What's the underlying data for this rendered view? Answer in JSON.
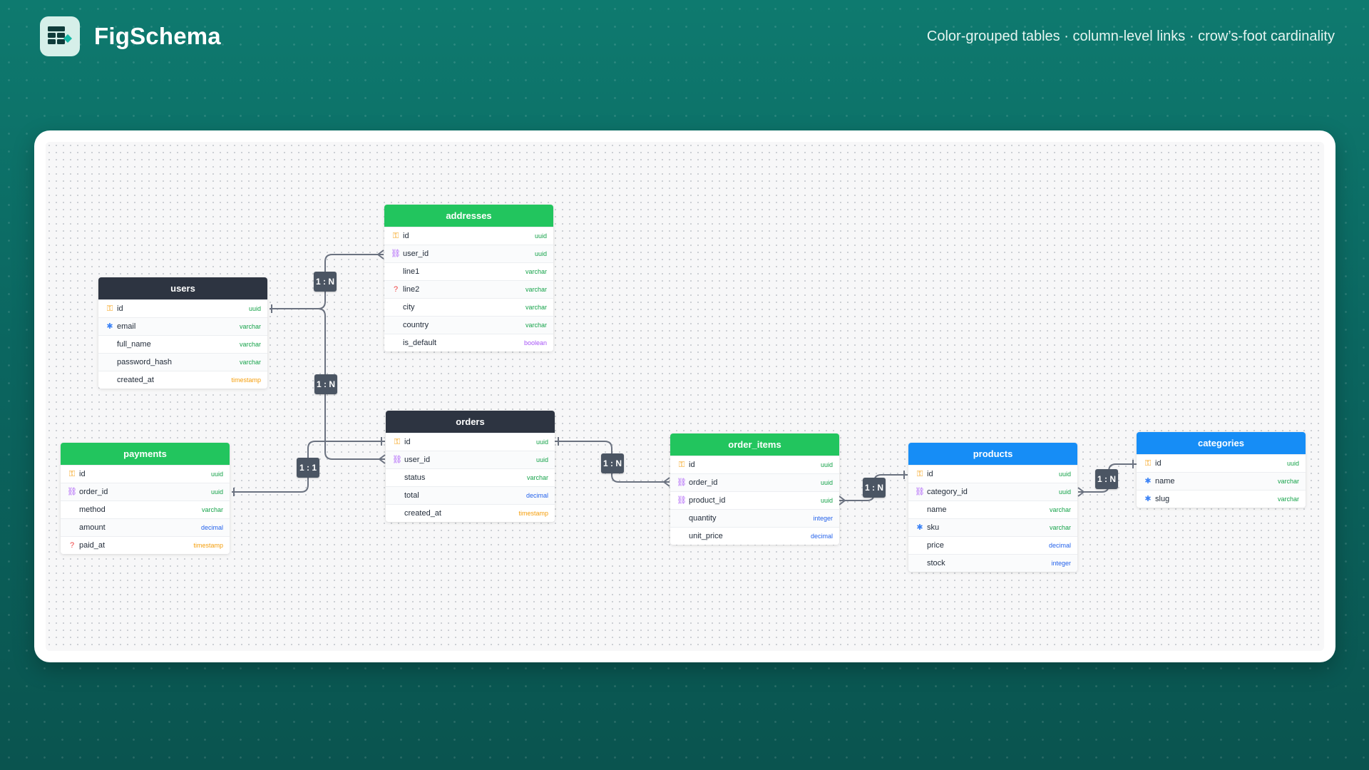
{
  "app": {
    "title": "FigSchema",
    "tagline": "Color-grouped tables · column-level links · crow’s-foot cardinality"
  },
  "colors": {
    "dark": "#2d3441",
    "green": "#22c55e",
    "blue": "#168df6",
    "uuid": "#16a34a",
    "varchar": "#16a34a",
    "timestamp": "#f59e0b",
    "decimal": "#2563eb",
    "integer": "#2563eb",
    "boolean": "#a855f7"
  },
  "tables": [
    {
      "name": "users",
      "color": "dark",
      "columns": [
        {
          "name": "id",
          "type": "uuid",
          "icon": "key-icon"
        },
        {
          "name": "email",
          "type": "varchar",
          "icon": "index-icon"
        },
        {
          "name": "full_name",
          "type": "varchar",
          "icon": ""
        },
        {
          "name": "password_hash",
          "type": "varchar",
          "icon": ""
        },
        {
          "name": "created_at",
          "type": "timestamp",
          "icon": ""
        }
      ]
    },
    {
      "name": "addresses",
      "color": "green",
      "columns": [
        {
          "name": "id",
          "type": "uuid",
          "icon": "key-icon"
        },
        {
          "name": "user_id",
          "type": "uuid",
          "icon": "link-icon"
        },
        {
          "name": "line1",
          "type": "varchar",
          "icon": ""
        },
        {
          "name": "line2",
          "type": "varchar",
          "icon": "nullable-icon"
        },
        {
          "name": "city",
          "type": "varchar",
          "icon": ""
        },
        {
          "name": "country",
          "type": "varchar",
          "icon": ""
        },
        {
          "name": "is_default",
          "type": "boolean",
          "icon": ""
        }
      ]
    },
    {
      "name": "orders",
      "color": "dark",
      "columns": [
        {
          "name": "id",
          "type": "uuid",
          "icon": "key-icon"
        },
        {
          "name": "user_id",
          "type": "uuid",
          "icon": "link-icon"
        },
        {
          "name": "status",
          "type": "varchar",
          "icon": ""
        },
        {
          "name": "total",
          "type": "decimal",
          "icon": ""
        },
        {
          "name": "created_at",
          "type": "timestamp",
          "icon": ""
        }
      ]
    },
    {
      "name": "payments",
      "color": "green",
      "columns": [
        {
          "name": "id",
          "type": "uuid",
          "icon": "key-icon"
        },
        {
          "name": "order_id",
          "type": "uuid",
          "icon": "link-icon"
        },
        {
          "name": "method",
          "type": "varchar",
          "icon": ""
        },
        {
          "name": "amount",
          "type": "decimal",
          "icon": ""
        },
        {
          "name": "paid_at",
          "type": "timestamp",
          "icon": "nullable-icon"
        }
      ]
    },
    {
      "name": "order_items",
      "color": "green",
      "columns": [
        {
          "name": "id",
          "type": "uuid",
          "icon": "key-icon"
        },
        {
          "name": "order_id",
          "type": "uuid",
          "icon": "link-icon"
        },
        {
          "name": "product_id",
          "type": "uuid",
          "icon": "link-icon"
        },
        {
          "name": "quantity",
          "type": "integer",
          "icon": ""
        },
        {
          "name": "unit_price",
          "type": "decimal",
          "icon": ""
        }
      ]
    },
    {
      "name": "products",
      "color": "blue",
      "columns": [
        {
          "name": "id",
          "type": "uuid",
          "icon": "key-icon"
        },
        {
          "name": "category_id",
          "type": "uuid",
          "icon": "link-icon"
        },
        {
          "name": "name",
          "type": "varchar",
          "icon": ""
        },
        {
          "name": "sku",
          "type": "varchar",
          "icon": "index-icon"
        },
        {
          "name": "price",
          "type": "decimal",
          "icon": ""
        },
        {
          "name": "stock",
          "type": "integer",
          "icon": ""
        }
      ]
    },
    {
      "name": "categories",
      "color": "blue",
      "columns": [
        {
          "name": "id",
          "type": "uuid",
          "icon": "key-icon"
        },
        {
          "name": "name",
          "type": "varchar",
          "icon": "index-icon"
        },
        {
          "name": "slug",
          "type": "varchar",
          "icon": "index-icon"
        }
      ]
    }
  ],
  "relations": [
    {
      "from_table": "users",
      "from_column": "id",
      "to_table": "addresses",
      "to_column": "user_id",
      "label": "1 : N"
    },
    {
      "from_table": "users",
      "from_column": "id",
      "to_table": "orders",
      "to_column": "user_id",
      "label": "1 : N"
    },
    {
      "from_table": "orders",
      "from_column": "id",
      "to_table": "payments",
      "to_column": "order_id",
      "label": "1 : 1"
    },
    {
      "from_table": "orders",
      "from_column": "id",
      "to_table": "order_items",
      "to_column": "order_id",
      "label": "1 : N"
    },
    {
      "from_table": "products",
      "from_column": "id",
      "to_table": "order_items",
      "to_column": "product_id",
      "label": "1 : N"
    },
    {
      "from_table": "categories",
      "from_column": "id",
      "to_table": "products",
      "to_column": "category_id",
      "label": "1 : N"
    }
  ]
}
